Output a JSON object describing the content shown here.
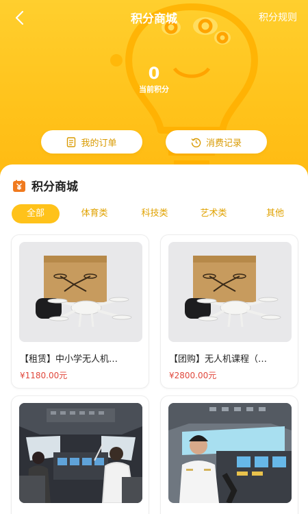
{
  "header": {
    "title": "积分商城",
    "rules_label": "积分规则",
    "points_value": "0",
    "points_label": "当前积分"
  },
  "actions": {
    "orders_label": "我的订单",
    "records_label": "消费记录"
  },
  "section": {
    "title": "积分商城",
    "tabs": [
      "全部",
      "体育类",
      "科技类",
      "艺术类",
      "其他"
    ],
    "active_tab": "全部"
  },
  "products": [
    {
      "name": "【租赁】中小学无人机…",
      "price": "¥1180.00元",
      "image": "drone-kit"
    },
    {
      "name": "【团购】无人机课程（…",
      "price": "¥2800.00元",
      "image": "drone-kit"
    },
    {
      "name": "",
      "price": "",
      "image": "flight-simulator-cockpit"
    },
    {
      "name": "",
      "price": "",
      "image": "pilot-in-cockpit"
    }
  ],
  "colors": {
    "brand_yellow": "#ffc21a",
    "price_red": "#e0473b",
    "accent_text": "#e0a200"
  }
}
